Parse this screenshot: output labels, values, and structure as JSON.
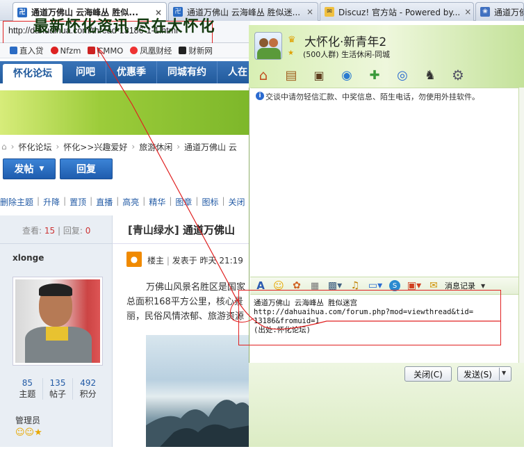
{
  "tabs": [
    {
      "title": "通道万佛山 云海峰丛 胜似...",
      "close": "×",
      "fav": "卍"
    },
    {
      "title": "通道万佛山 云海峰丛 胜似迷...",
      "close": "×",
      "fav": "卍"
    },
    {
      "title": "Discuz! 官方站 - Powered by...",
      "close": "×",
      "fav": "✉"
    },
    {
      "title": "通道万佛",
      "close": "",
      "fav": "❀"
    }
  ],
  "address": {
    "url": "http://dahuaihua.com/thread-13186-1-1.html"
  },
  "bookmarks": [
    "直入贷",
    "Nfzm",
    "CMMO",
    "凤凰财经",
    "财新网"
  ],
  "forum": {
    "nav": [
      "怀化论坛",
      "问吧",
      "优惠季",
      "同城有约",
      "人在"
    ],
    "banner": "最新怀化资讯  尽在大怀化",
    "breadcrumb": [
      "怀化论坛",
      "怀化>>兴趣爱好",
      "旅游休闲",
      "通道万佛山 云"
    ],
    "post_btn": "发帖",
    "reply_btn": "回复",
    "mod_links": [
      "删除主题",
      "升降",
      "置顶",
      "直播",
      "高亮",
      "精华",
      "图章",
      "图标",
      "关闭"
    ],
    "views_label": "查看:",
    "views": "15",
    "replies_label": "回复:",
    "replies": "0",
    "thread_tag": "[青山绿水]",
    "thread_title": "通道万佛山",
    "author": "xlonge",
    "floor": "楼主",
    "posted": "发表于 昨天 21:19",
    "stats": [
      {
        "n": "85",
        "l": "主题"
      },
      {
        "n": "135",
        "l": "帖子"
      },
      {
        "n": "492",
        "l": "积分"
      }
    ],
    "role": "管理员",
    "body1": "万佛山风景名胜区是国家",
    "body2": "总面积168平方公里，核心景",
    "body3": "丽，民俗风情浓郁、旅游资源"
  },
  "qq": {
    "group_name": "大怀化·新青年2",
    "group_sub": "(500人群) 生活休闲-同城",
    "notice": "交谈中请勿轻信汇款、中奖信息、陌生电话，勿使用外挂软件。",
    "input": [
      "通道万佛山 云海峰丛 胜似迷宫",
      "http://dahuaihua.com/forum.php?mod=viewthread&tid=",
      "13186&fromuid=1",
      "(出处:怀化论坛)"
    ],
    "msg_record": "消息记录",
    "close_btn": "关闭(C)",
    "send_btn": "发送(S)"
  },
  "colors": {
    "accent": "#215a9c",
    "red_annot": "#e02020",
    "qq_green": "#c4e29a"
  }
}
